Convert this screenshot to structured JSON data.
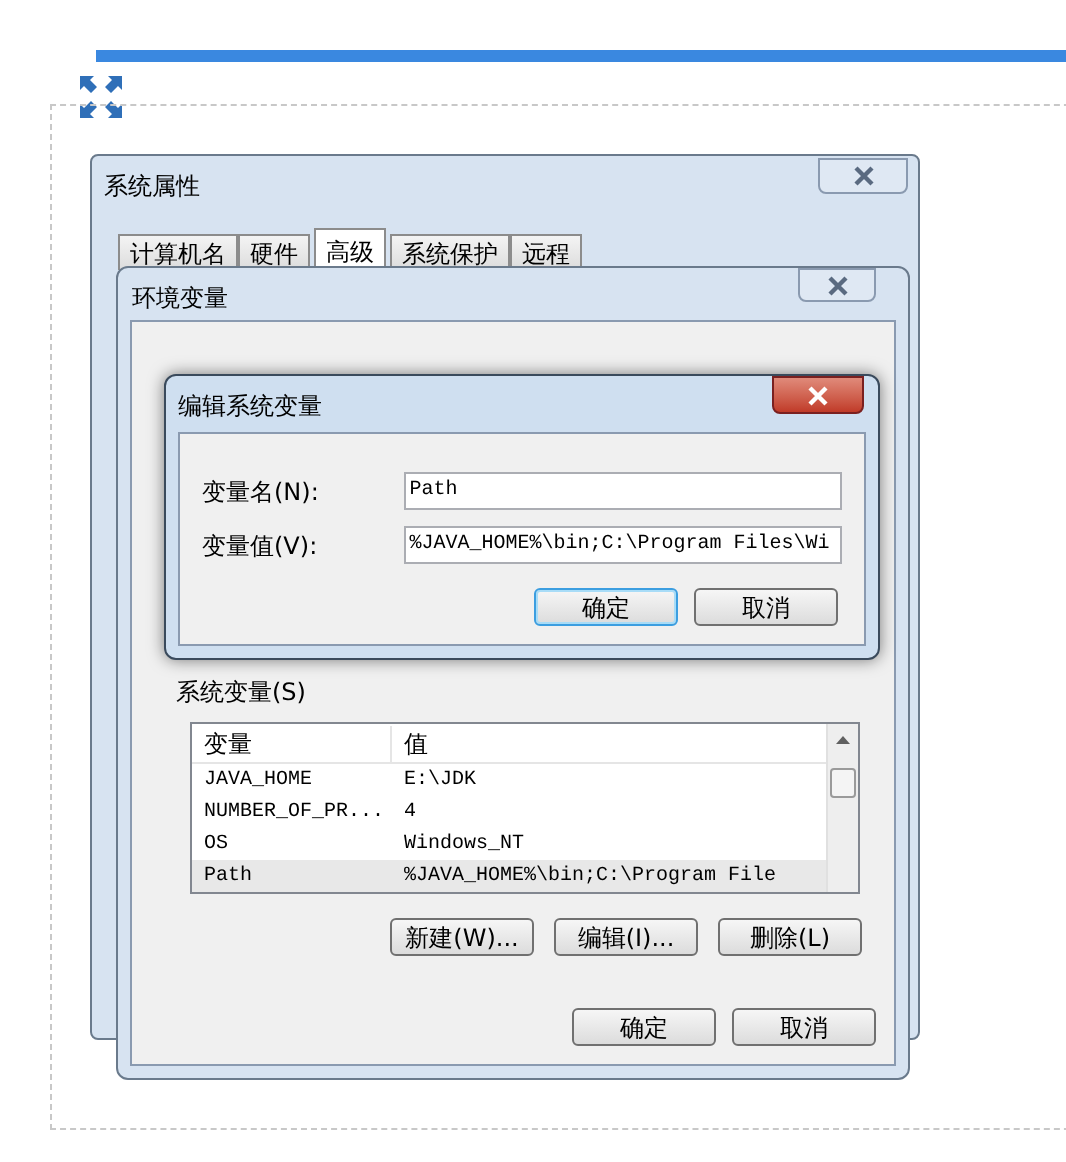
{
  "system_properties": {
    "title": "系统属性",
    "tabs": [
      {
        "label": "计算机名",
        "selected": false
      },
      {
        "label": "硬件",
        "selected": false
      },
      {
        "label": "高级",
        "selected": true
      },
      {
        "label": "系统保护",
        "selected": false
      },
      {
        "label": "远程",
        "selected": false
      }
    ]
  },
  "environment_variables": {
    "title": "环境变量",
    "system_variables": {
      "label": "系统变量(S)",
      "columns": [
        "变量",
        "值"
      ],
      "rows": [
        {
          "name": "JAVA_HOME",
          "value": "E:\\JDK",
          "selected": false
        },
        {
          "name": "NUMBER_OF_PR...",
          "value": "4",
          "selected": false
        },
        {
          "name": "OS",
          "value": "Windows_NT",
          "selected": false
        },
        {
          "name": "Path",
          "value": "%JAVA_HOME%\\bin;C:\\Program File",
          "selected": true
        }
      ],
      "buttons": [
        "新建(W)...",
        "编辑(I)...",
        "删除(L)"
      ]
    },
    "buttons": [
      "确定",
      "取消"
    ]
  },
  "edit_dialog": {
    "title": "编辑系统变量",
    "fields": [
      {
        "label": "变量名(N):",
        "value": "Path"
      },
      {
        "label": "变量值(V):",
        "value": "%JAVA_HOME%\\bin;C:\\Program Files\\Wi"
      }
    ],
    "buttons": [
      {
        "label": "确定",
        "default": true
      },
      {
        "label": "取消",
        "default": false
      }
    ]
  }
}
